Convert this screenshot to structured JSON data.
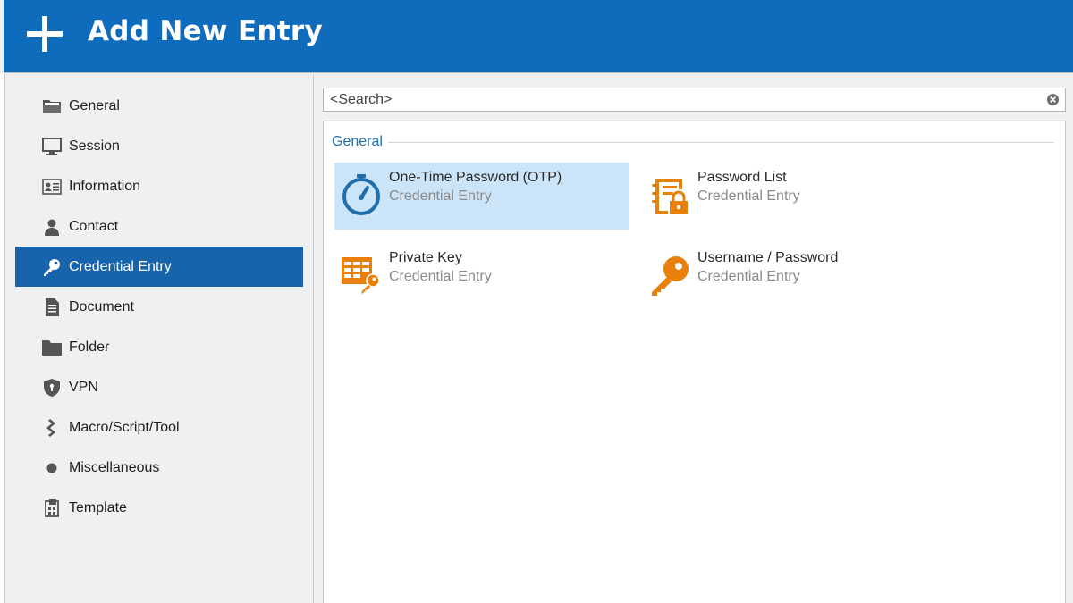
{
  "header": {
    "title": "Add New Entry",
    "icon": "plus-icon",
    "color": "#0f6cbd"
  },
  "sidebar": {
    "items": [
      {
        "label": "General",
        "icon": "folder-open-icon"
      },
      {
        "label": "Session",
        "icon": "monitor-icon"
      },
      {
        "label": "Information",
        "icon": "id-card-icon"
      },
      {
        "label": "Contact",
        "icon": "person-icon"
      },
      {
        "label": "Credential Entry",
        "icon": "key-icon",
        "selected": true
      },
      {
        "label": "Document",
        "icon": "document-icon"
      },
      {
        "label": "Folder",
        "icon": "folder-icon"
      },
      {
        "label": "VPN",
        "icon": "shield-lock-icon"
      },
      {
        "label": "Macro/Script/Tool",
        "icon": "script-icon"
      },
      {
        "label": "Miscellaneous",
        "icon": "dot-icon"
      },
      {
        "label": "Template",
        "icon": "template-icon"
      }
    ],
    "selected_color": "#1764ad"
  },
  "search": {
    "placeholder": "<Search>",
    "value": ""
  },
  "group": {
    "title": "General",
    "entries": [
      {
        "name": "One-Time Password (OTP)",
        "type": "Credential Entry",
        "icon": "stopwatch-icon",
        "selected": true
      },
      {
        "name": "Password List",
        "type": "Credential Entry",
        "icon": "password-list-icon"
      },
      {
        "name": "Private Key",
        "type": "Credential Entry",
        "icon": "private-key-icon"
      },
      {
        "name": "Username / Password",
        "type": "Credential Entry",
        "icon": "key-icon"
      }
    ]
  },
  "colors": {
    "accent_orange": "#e8800c",
    "otp_blue": "#1f6fae",
    "tile_selected": "#cce4f7"
  }
}
